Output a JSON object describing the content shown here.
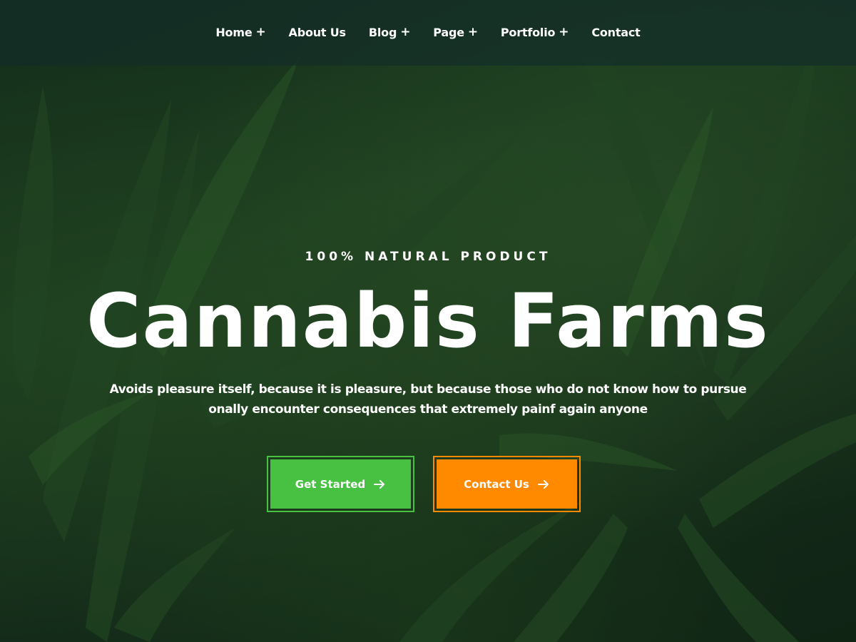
{
  "nav": {
    "items": [
      {
        "label": "Home",
        "suffix": "+"
      },
      {
        "label": "About Us",
        "suffix": ""
      },
      {
        "label": "Blog",
        "suffix": "+"
      },
      {
        "label": "Page",
        "suffix": "+"
      },
      {
        "label": "Portfolio",
        "suffix": "+"
      },
      {
        "label": "Contact",
        "suffix": ""
      }
    ]
  },
  "hero": {
    "kicker": "100% NATURAL PRODUCT",
    "title": "Cannabis Farms",
    "lead_line1": "Avoids pleasure itself, because it is pleasure, but because those who do not know how to pursue",
    "lead_line2": "onally encounter consequences that extremely painf again anyone",
    "background": "cannabis-leaves-photo"
  },
  "buttons": {
    "primary": {
      "label": "Get Started",
      "icon": "arrow-right-icon",
      "color": "#48c143"
    },
    "secondary": {
      "label": "Contact Us",
      "icon": "arrow-right-icon",
      "color": "#ff8a00"
    }
  },
  "colors": {
    "nav_bg": "#142d28",
    "accent_green": "#48c143",
    "accent_orange": "#ff8a00"
  }
}
